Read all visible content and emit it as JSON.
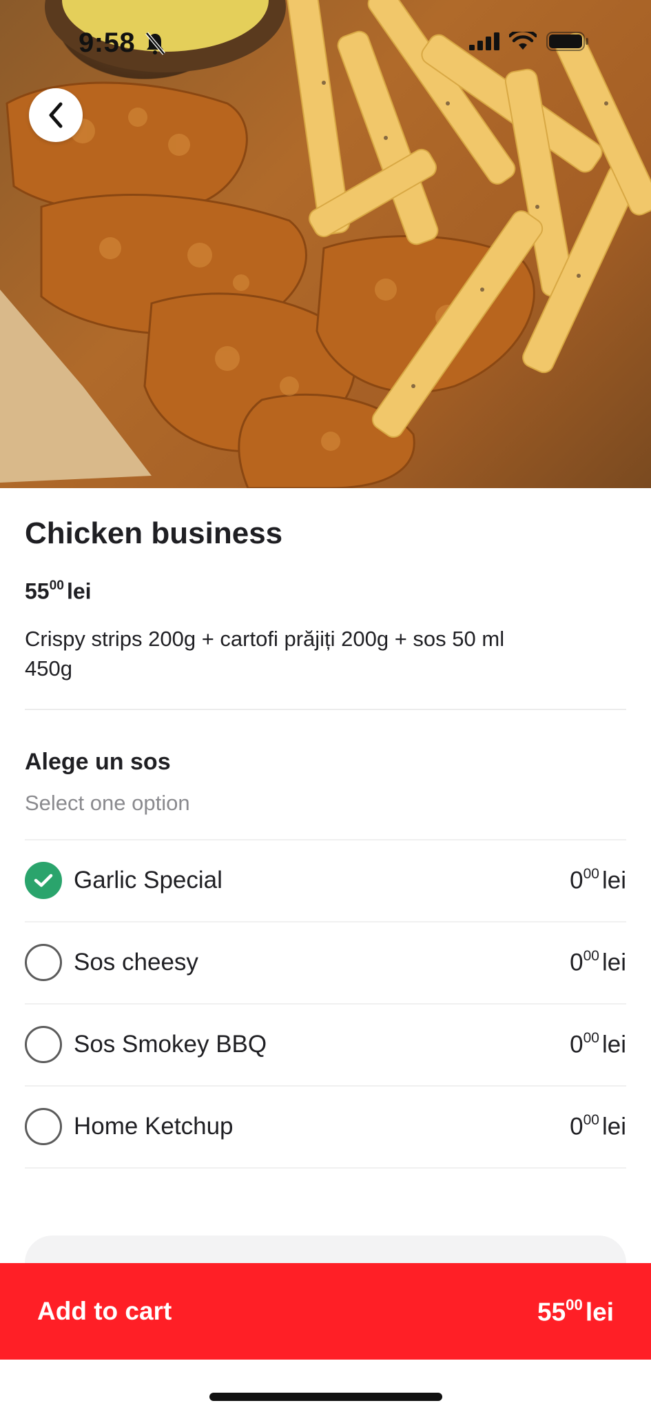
{
  "status_bar": {
    "time": "9:58"
  },
  "product": {
    "title": "Chicken business",
    "price_main": "55",
    "price_cents": "00",
    "currency": "lei",
    "description_line1": "Crispy strips 200g + cartofi prăjiți 200g + sos 50 ml",
    "description_line2": "450g"
  },
  "sauce_group": {
    "title": "Alege un sos",
    "subtitle": "Select one option",
    "options": [
      {
        "label": "Garlic Special",
        "price_main": "0",
        "price_cents": "00",
        "currency": "lei",
        "selected": true
      },
      {
        "label": "Sos cheesy",
        "price_main": "0",
        "price_cents": "00",
        "currency": "lei",
        "selected": false
      },
      {
        "label": "Sos Smokey BBQ",
        "price_main": "0",
        "price_cents": "00",
        "currency": "lei",
        "selected": false
      },
      {
        "label": "Home Ketchup",
        "price_main": "0",
        "price_cents": "00",
        "currency": "lei",
        "selected": false
      }
    ]
  },
  "cart": {
    "label": "Add to cart",
    "price_main": "55",
    "price_cents": "00",
    "currency": "lei"
  },
  "colors": {
    "accent": "#ff1f26",
    "selected": "#2aa46c"
  },
  "icons": [
    "back-arrow-icon",
    "bell-slash-icon",
    "signal-icon",
    "wifi-icon",
    "battery-icon",
    "checkmark-icon"
  ]
}
